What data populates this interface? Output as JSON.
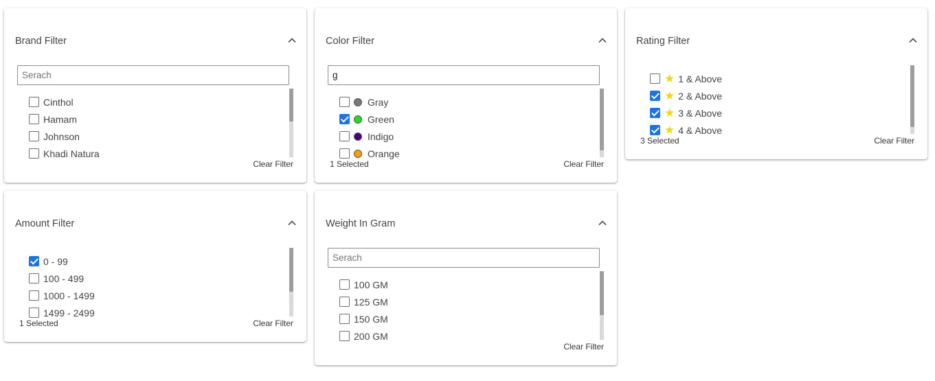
{
  "brand": {
    "title": "Brand Filter",
    "search_placeholder": "Serach",
    "search_value": "",
    "items": [
      {
        "label": "Cinthol",
        "checked": false
      },
      {
        "label": "Hamam",
        "checked": false
      },
      {
        "label": "Johnson",
        "checked": false
      },
      {
        "label": "Khadi Natura",
        "checked": false
      }
    ],
    "clear_label": "Clear Filter"
  },
  "color": {
    "title": "Color Filter",
    "search_placeholder": "Serach",
    "search_value": "g",
    "items": [
      {
        "label": "Gray",
        "checked": false,
        "swatch": "#7a7a7a"
      },
      {
        "label": "Green",
        "checked": true,
        "swatch": "#22dd22"
      },
      {
        "label": "Indigo",
        "checked": false,
        "swatch": "#4b0082"
      },
      {
        "label": "Orange",
        "checked": false,
        "swatch": "#f5a300"
      }
    ],
    "selected_text": "1 Selected",
    "clear_label": "Clear Filter"
  },
  "rating": {
    "title": "Rating Filter",
    "items": [
      {
        "label": "1 & Above",
        "checked": false
      },
      {
        "label": "2 & Above",
        "checked": true
      },
      {
        "label": "3 & Above",
        "checked": true
      },
      {
        "label": "4 & Above",
        "checked": true
      }
    ],
    "selected_text": "3 Selected",
    "clear_label": "Clear Filter",
    "star_icon": "star-icon",
    "star_color": "#f5d800"
  },
  "amount": {
    "title": "Amount Filter",
    "items": [
      {
        "label": "0 - 99",
        "checked": true
      },
      {
        "label": "100 - 499",
        "checked": false
      },
      {
        "label": "1000 - 1499",
        "checked": false
      },
      {
        "label": "1499 - 2499",
        "checked": false
      }
    ],
    "selected_text": "1 Selected",
    "clear_label": "Clear Filter"
  },
  "weight": {
    "title": "Weight In Gram",
    "search_placeholder": "Serach",
    "search_value": "",
    "items": [
      {
        "label": "100 GM",
        "checked": false
      },
      {
        "label": "125 GM",
        "checked": false
      },
      {
        "label": "150 GM",
        "checked": false
      },
      {
        "label": "200 GM",
        "checked": false
      }
    ],
    "clear_label": "Clear Filter"
  },
  "colors": {
    "accent": "#1a73e8",
    "scroll_track": "#d9d9d9",
    "scroll_thumb": "#9e9e9e"
  },
  "icons": {
    "collapse": "chevron-up-icon"
  }
}
